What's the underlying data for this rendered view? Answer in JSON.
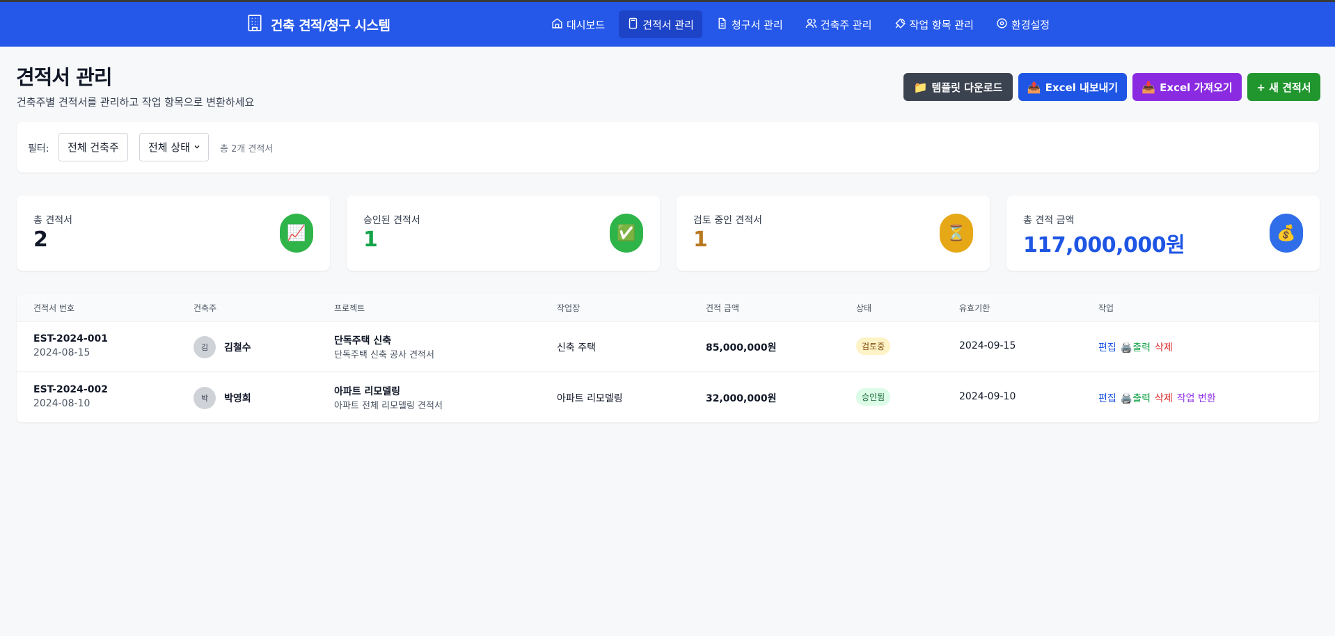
{
  "app": {
    "title": "건축 견적/청구 시스템"
  },
  "nav": {
    "items": [
      {
        "label": "대시보드",
        "icon": "home-icon"
      },
      {
        "label": "견적서 관리",
        "icon": "calculator-icon",
        "active": true
      },
      {
        "label": "청구서 관리",
        "icon": "document-icon"
      },
      {
        "label": "건축주 관리",
        "icon": "users-icon"
      },
      {
        "label": "작업 항목 관리",
        "icon": "tools-icon"
      },
      {
        "label": "환경설정",
        "icon": "settings-icon"
      }
    ]
  },
  "page": {
    "title": "견적서 관리",
    "subtitle": "건축주별 견적서를 관리하고 작업 항목으로 변환하세요"
  },
  "actions": {
    "template_download": {
      "icon": "📁",
      "label": "템플릿 다운로드"
    },
    "excel_export": {
      "icon": "📤",
      "label": "Excel 내보내기"
    },
    "excel_import": {
      "icon": "📥",
      "label": "Excel 가져오기"
    },
    "new_estimate": "+ 새 견적서"
  },
  "filter": {
    "label": "필터:",
    "builder_select": "전체 건축주",
    "status_select": "전체 상태",
    "count_text": "총 2개 견적서"
  },
  "stats": [
    {
      "label": "총 견적서",
      "value": "2",
      "icon": "📈",
      "color": "#111827",
      "icon_bg": "#2fb44a"
    },
    {
      "label": "승인된 견적서",
      "value": "1",
      "icon": "✅",
      "color": "#16a34a",
      "icon_bg": "#2fb44a"
    },
    {
      "label": "검토 중인 견적서",
      "value": "1",
      "icon": "⏳",
      "color": "#b7791f",
      "icon_bg": "#e6a817"
    },
    {
      "label": "총 견적 금액",
      "value": "117,000,000원",
      "icon": "💰",
      "color": "#1e55e4",
      "icon_bg": "#2f6ee8"
    }
  ],
  "table": {
    "headers": [
      "견적서 번호",
      "건축주",
      "프로젝트",
      "작업장",
      "견적 금액",
      "상태",
      "유효기한",
      "작업"
    ],
    "rows": [
      {
        "number": "EST-2024-001",
        "date": "2024-08-15",
        "avatar": "김",
        "owner": "김철수",
        "project": "단독주택 신축",
        "project_desc": "단독주택 신축 공사 견적서",
        "site": "신축 주택",
        "amount": "85,000,000원",
        "status": "검토중",
        "valid_until": "2024-09-15",
        "actions": {
          "edit": "편집",
          "print_icon": "🖨️",
          "print": "출력",
          "delete": "삭제"
        }
      },
      {
        "number": "EST-2024-002",
        "date": "2024-08-10",
        "avatar": "박",
        "owner": "박영희",
        "project": "아파트 리모델링",
        "project_desc": "아파트 전체 리모델링 견적서",
        "site": "아파트 리모델링",
        "amount": "32,000,000원",
        "status": "승인됨",
        "valid_until": "2024-09-10",
        "actions": {
          "edit": "편집",
          "print_icon": "🖨️",
          "print": "출력",
          "delete": "삭제",
          "convert": "작업 변환"
        }
      }
    ]
  }
}
